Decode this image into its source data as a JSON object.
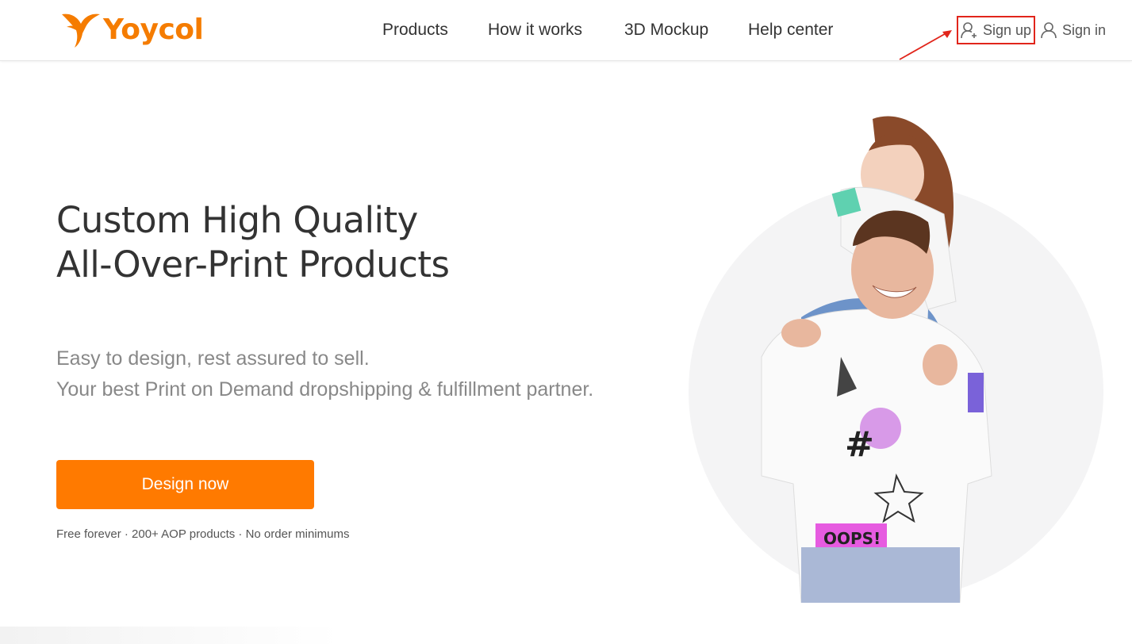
{
  "header": {
    "brand": "Yoycol",
    "nav": [
      {
        "label": "Products"
      },
      {
        "label": "How it works"
      },
      {
        "label": "3D Mockup"
      },
      {
        "label": "Help center"
      }
    ],
    "signup_label": "Sign up",
    "signin_label": "Sign in"
  },
  "hero": {
    "title_line1": "Custom High Quality",
    "title_line2": "All-Over-Print Products",
    "subtitle_line1": "Easy to design, rest assured to sell.",
    "subtitle_line2": "Your best Print on Demand dropshipping & fulfillment partner.",
    "cta_label": "Design now",
    "features": "Free forever · 200+ AOP products · No order minimums"
  },
  "colors": {
    "brand": "#f57c00",
    "cta": "#ff7a00",
    "highlight": "#e1251b"
  },
  "icons": {
    "logo": "yoycol-bird-icon",
    "signup": "user-add-icon",
    "signin": "user-icon"
  }
}
